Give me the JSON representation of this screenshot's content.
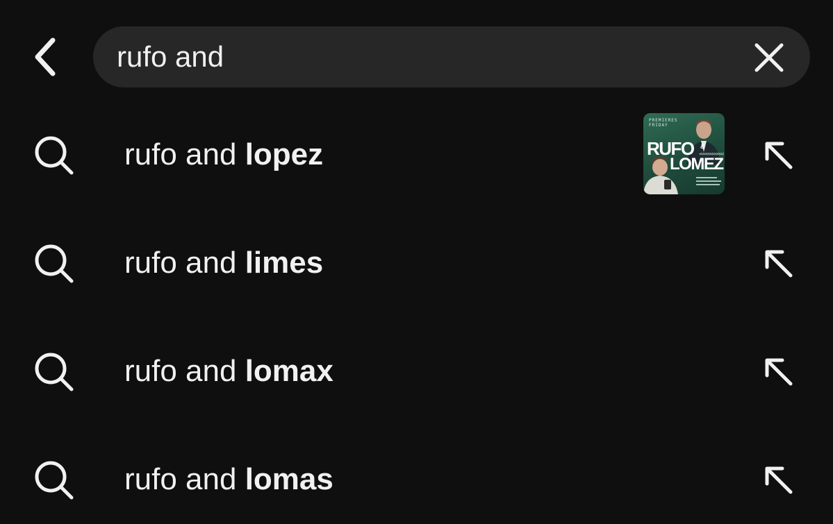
{
  "search": {
    "query": "rufo and",
    "back_icon": "chevron-left-icon",
    "clear_icon": "close-icon"
  },
  "suggestions": [
    {
      "prefix": "rufo and ",
      "completion": "lopez",
      "icon": "search-icon",
      "fill_icon": "arrow-up-left-icon",
      "has_thumbnail": true,
      "thumbnail": {
        "premieres_text": "PREMIERES FRIDAY",
        "title_line1": "RUFO",
        "ampersand": "&",
        "title_line2": "LOMEZ",
        "chevrons": "<<<<<<<<<<<"
      }
    },
    {
      "prefix": "rufo and ",
      "completion": "limes",
      "icon": "search-icon",
      "fill_icon": "arrow-up-left-icon",
      "has_thumbnail": false
    },
    {
      "prefix": "rufo and ",
      "completion": "lomax",
      "icon": "search-icon",
      "fill_icon": "arrow-up-left-icon",
      "has_thumbnail": false
    },
    {
      "prefix": "rufo and ",
      "completion": "lomas",
      "icon": "search-icon",
      "fill_icon": "arrow-up-left-icon",
      "has_thumbnail": false
    }
  ],
  "colors": {
    "background": "#0f0f0f",
    "search_bar": "#272727",
    "text": "#f1f1f1",
    "thumbnail_green": "#2f6b55"
  }
}
